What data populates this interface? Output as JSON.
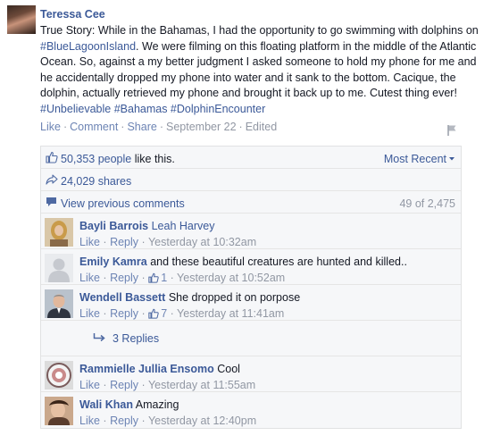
{
  "post": {
    "author": "Teressa Cee",
    "text_1": "True Story: While in the Bahamas, I had the opportunity to go swimming with dolphins on ",
    "tag_1": "#BlueLagoonIsland",
    "text_2": ". We were filming on this floating platform in the middle of the Atlantic Ocean. So, against a my better judgment I asked someone to hold my phone for me and he accidentally dropped my phone into water and it sank to the bottom. Cacique, the dolphin, actually retrieved my phone and brought it back up to me. Cutest thing ever!",
    "tags_2": "#Unbelievable #Bahamas #DolphinEncounter",
    "actions": {
      "like": "Like",
      "comment": "Comment",
      "share": "Share",
      "date": "September 22",
      "edited": "Edited"
    }
  },
  "ufi": {
    "likes_count": "50,353 people",
    "likes_suffix": " like this.",
    "sort": "Most Recent",
    "shares": "24,029 shares",
    "view_previous": "View previous comments",
    "count_label": "49 of 2,475"
  },
  "comments": [
    {
      "name": "Bayli Barrois",
      "text": "Leah Harvey",
      "text_is_tag": true,
      "like": "Like",
      "reply": "Reply",
      "likes": "",
      "time": "Yesterday at 10:32am"
    },
    {
      "name": "Emily Kamra",
      "text": "and these beautiful creatures are hunted and killed..",
      "like": "Like",
      "reply": "Reply",
      "likes": "1",
      "time": "Yesterday at 10:52am"
    },
    {
      "name": "Wendell Bassett",
      "text": "She dropped it on porpose",
      "like": "Like",
      "reply": "Reply",
      "likes": "7",
      "time": "Yesterday at 11:41am"
    },
    {
      "name": "Rammielle Jullia Ensomo",
      "text": "Cool",
      "like": "Like",
      "reply": "Reply",
      "likes": "",
      "time": "Yesterday at 11:55am"
    },
    {
      "name": "Wali Khan",
      "text": "Amazing",
      "like": "Like",
      "reply": "Reply",
      "likes": "",
      "time": "Yesterday at 12:40pm"
    }
  ],
  "replies": {
    "label": "3 Replies"
  },
  "sep": "·"
}
